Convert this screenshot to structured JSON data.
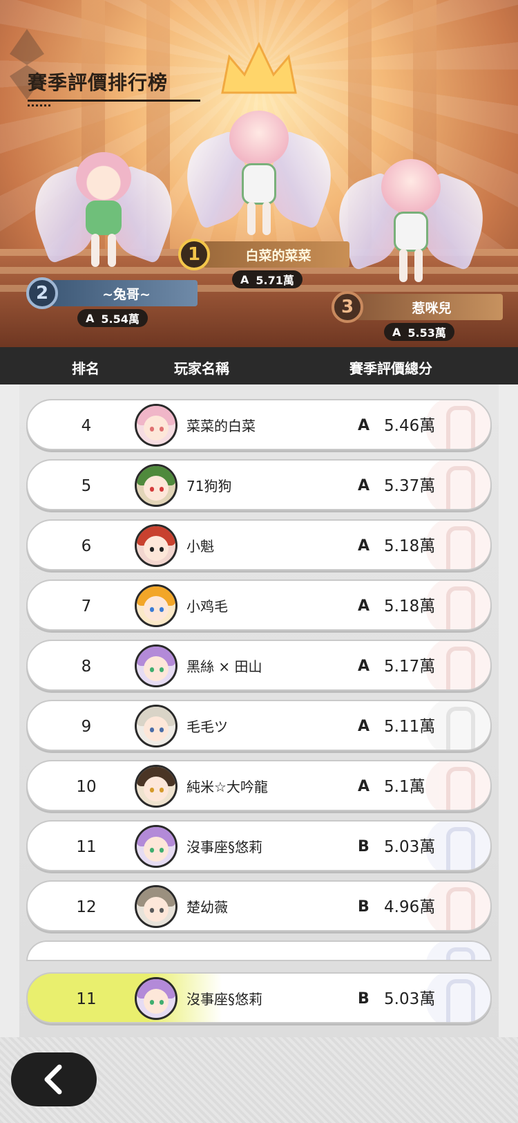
{
  "title": "賽季評價排行榜",
  "podium": [
    {
      "rank": "1",
      "name": "白菜的菜菜",
      "grade": "A",
      "score": "5.71萬"
    },
    {
      "rank": "2",
      "name": "~兔哥~",
      "grade": "A",
      "score": "5.54萬"
    },
    {
      "rank": "3",
      "name": "惹咪兒",
      "grade": "A",
      "score": "5.53萬"
    }
  ],
  "header": {
    "rank": "排名",
    "player": "玩家名稱",
    "score": "賽季評價總分"
  },
  "rows": [
    {
      "rank": "4",
      "name": "菜菜的白菜",
      "grade": "A",
      "score": "5.46萬"
    },
    {
      "rank": "5",
      "name": "71狗狗",
      "grade": "A",
      "score": "5.37萬"
    },
    {
      "rank": "6",
      "name": "小魁",
      "grade": "A",
      "score": "5.18萬"
    },
    {
      "rank": "7",
      "name": "小鸡毛",
      "grade": "A",
      "score": "5.18萬"
    },
    {
      "rank": "8",
      "name": "黑絲 × 田山",
      "grade": "A",
      "score": "5.17萬"
    },
    {
      "rank": "9",
      "name": "毛毛ツ",
      "grade": "A",
      "score": "5.11萬"
    },
    {
      "rank": "10",
      "name": "純米☆大吟龍",
      "grade": "A",
      "score": "5.1萬"
    },
    {
      "rank": "11",
      "name": "沒事座§悠莉",
      "grade": "B",
      "score": "5.03萬"
    },
    {
      "rank": "12",
      "name": "楚幼薇",
      "grade": "B",
      "score": "4.96萬"
    }
  ],
  "my_row": {
    "rank": "11",
    "name": "沒事座§悠莉",
    "grade": "B",
    "score": "5.03萬"
  },
  "icons": {
    "back": "back-arrow-icon"
  },
  "colors": {
    "header_bg": "#2a2a2a",
    "emblem_red": "#c0584e",
    "emblem_blue": "#5a6ab0",
    "emblem_gray": "#808080",
    "my_row_highlight": "#e9ef6e"
  }
}
